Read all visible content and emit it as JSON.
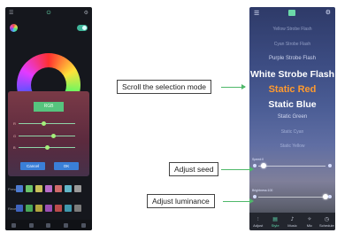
{
  "left_phone": {
    "top_icons": [
      "menu-icon",
      "power-icon",
      "gear-icon"
    ],
    "dialog": {
      "mode_button": "RGB",
      "sliders": [
        {
          "channel": "R",
          "level": 0.45
        },
        {
          "channel": "G",
          "level": 0.62
        },
        {
          "channel": "B",
          "level": 0.5
        }
      ],
      "cancel_label": "Cancel",
      "ok_label": "OK"
    },
    "swatch_rows": [
      {
        "label": "Preset",
        "colors": [
          "#4d7bd1",
          "#6bc46a",
          "#c9c05a",
          "#b86cc8",
          "#d06b6b",
          "#62b6c9",
          "#9a9a9a"
        ]
      },
      {
        "label": "Recent",
        "colors": [
          "#3e63bd",
          "#49a858",
          "#b3a53f",
          "#9c4fb3",
          "#bb4c4c",
          "#3f98ae",
          "#7c7c7c"
        ]
      }
    ]
  },
  "right_phone": {
    "top_icons": [
      "menu-icon",
      "power-icon",
      "gear-icon"
    ],
    "mode_list": [
      {
        "text": "Yellow Strobe Flash",
        "style": "dim"
      },
      {
        "text": "Cyan Strobe Flash",
        "style": "dim"
      },
      {
        "text": "Purple Strobe Flash",
        "style": "mid"
      },
      {
        "text": "White Strobe Flash",
        "style": "big"
      },
      {
        "text": "Static Red",
        "style": "sel"
      },
      {
        "text": "Static Blue",
        "style": "big"
      },
      {
        "text": "Static Green",
        "style": "mid"
      },
      {
        "text": "Static Cyan",
        "style": "dim"
      },
      {
        "text": "Static Yellow",
        "style": "dim"
      }
    ],
    "speed_label": "Speed:0",
    "speed_level": 0.08,
    "brightness_label": "Brightness:100",
    "brightness_level": 1.0,
    "tabs": [
      {
        "label": "Adjust",
        "icon": "sliders-icon",
        "active": false
      },
      {
        "label": "Style",
        "icon": "style-icon",
        "active": true
      },
      {
        "label": "Music",
        "icon": "music-icon",
        "active": false
      },
      {
        "label": "Mic",
        "icon": "mic-icon",
        "active": false
      },
      {
        "label": "Schedule",
        "icon": "schedule-icon",
        "active": false
      }
    ]
  },
  "callouts": {
    "scroll": "Scroll the selection mode",
    "speed": "Adjust seed",
    "luminance": "Adjust luminance"
  },
  "colors": {
    "accent_green": "#4fb86a",
    "selected_mode": "#ff9a2e",
    "active_tab": "#5fd7ad"
  }
}
